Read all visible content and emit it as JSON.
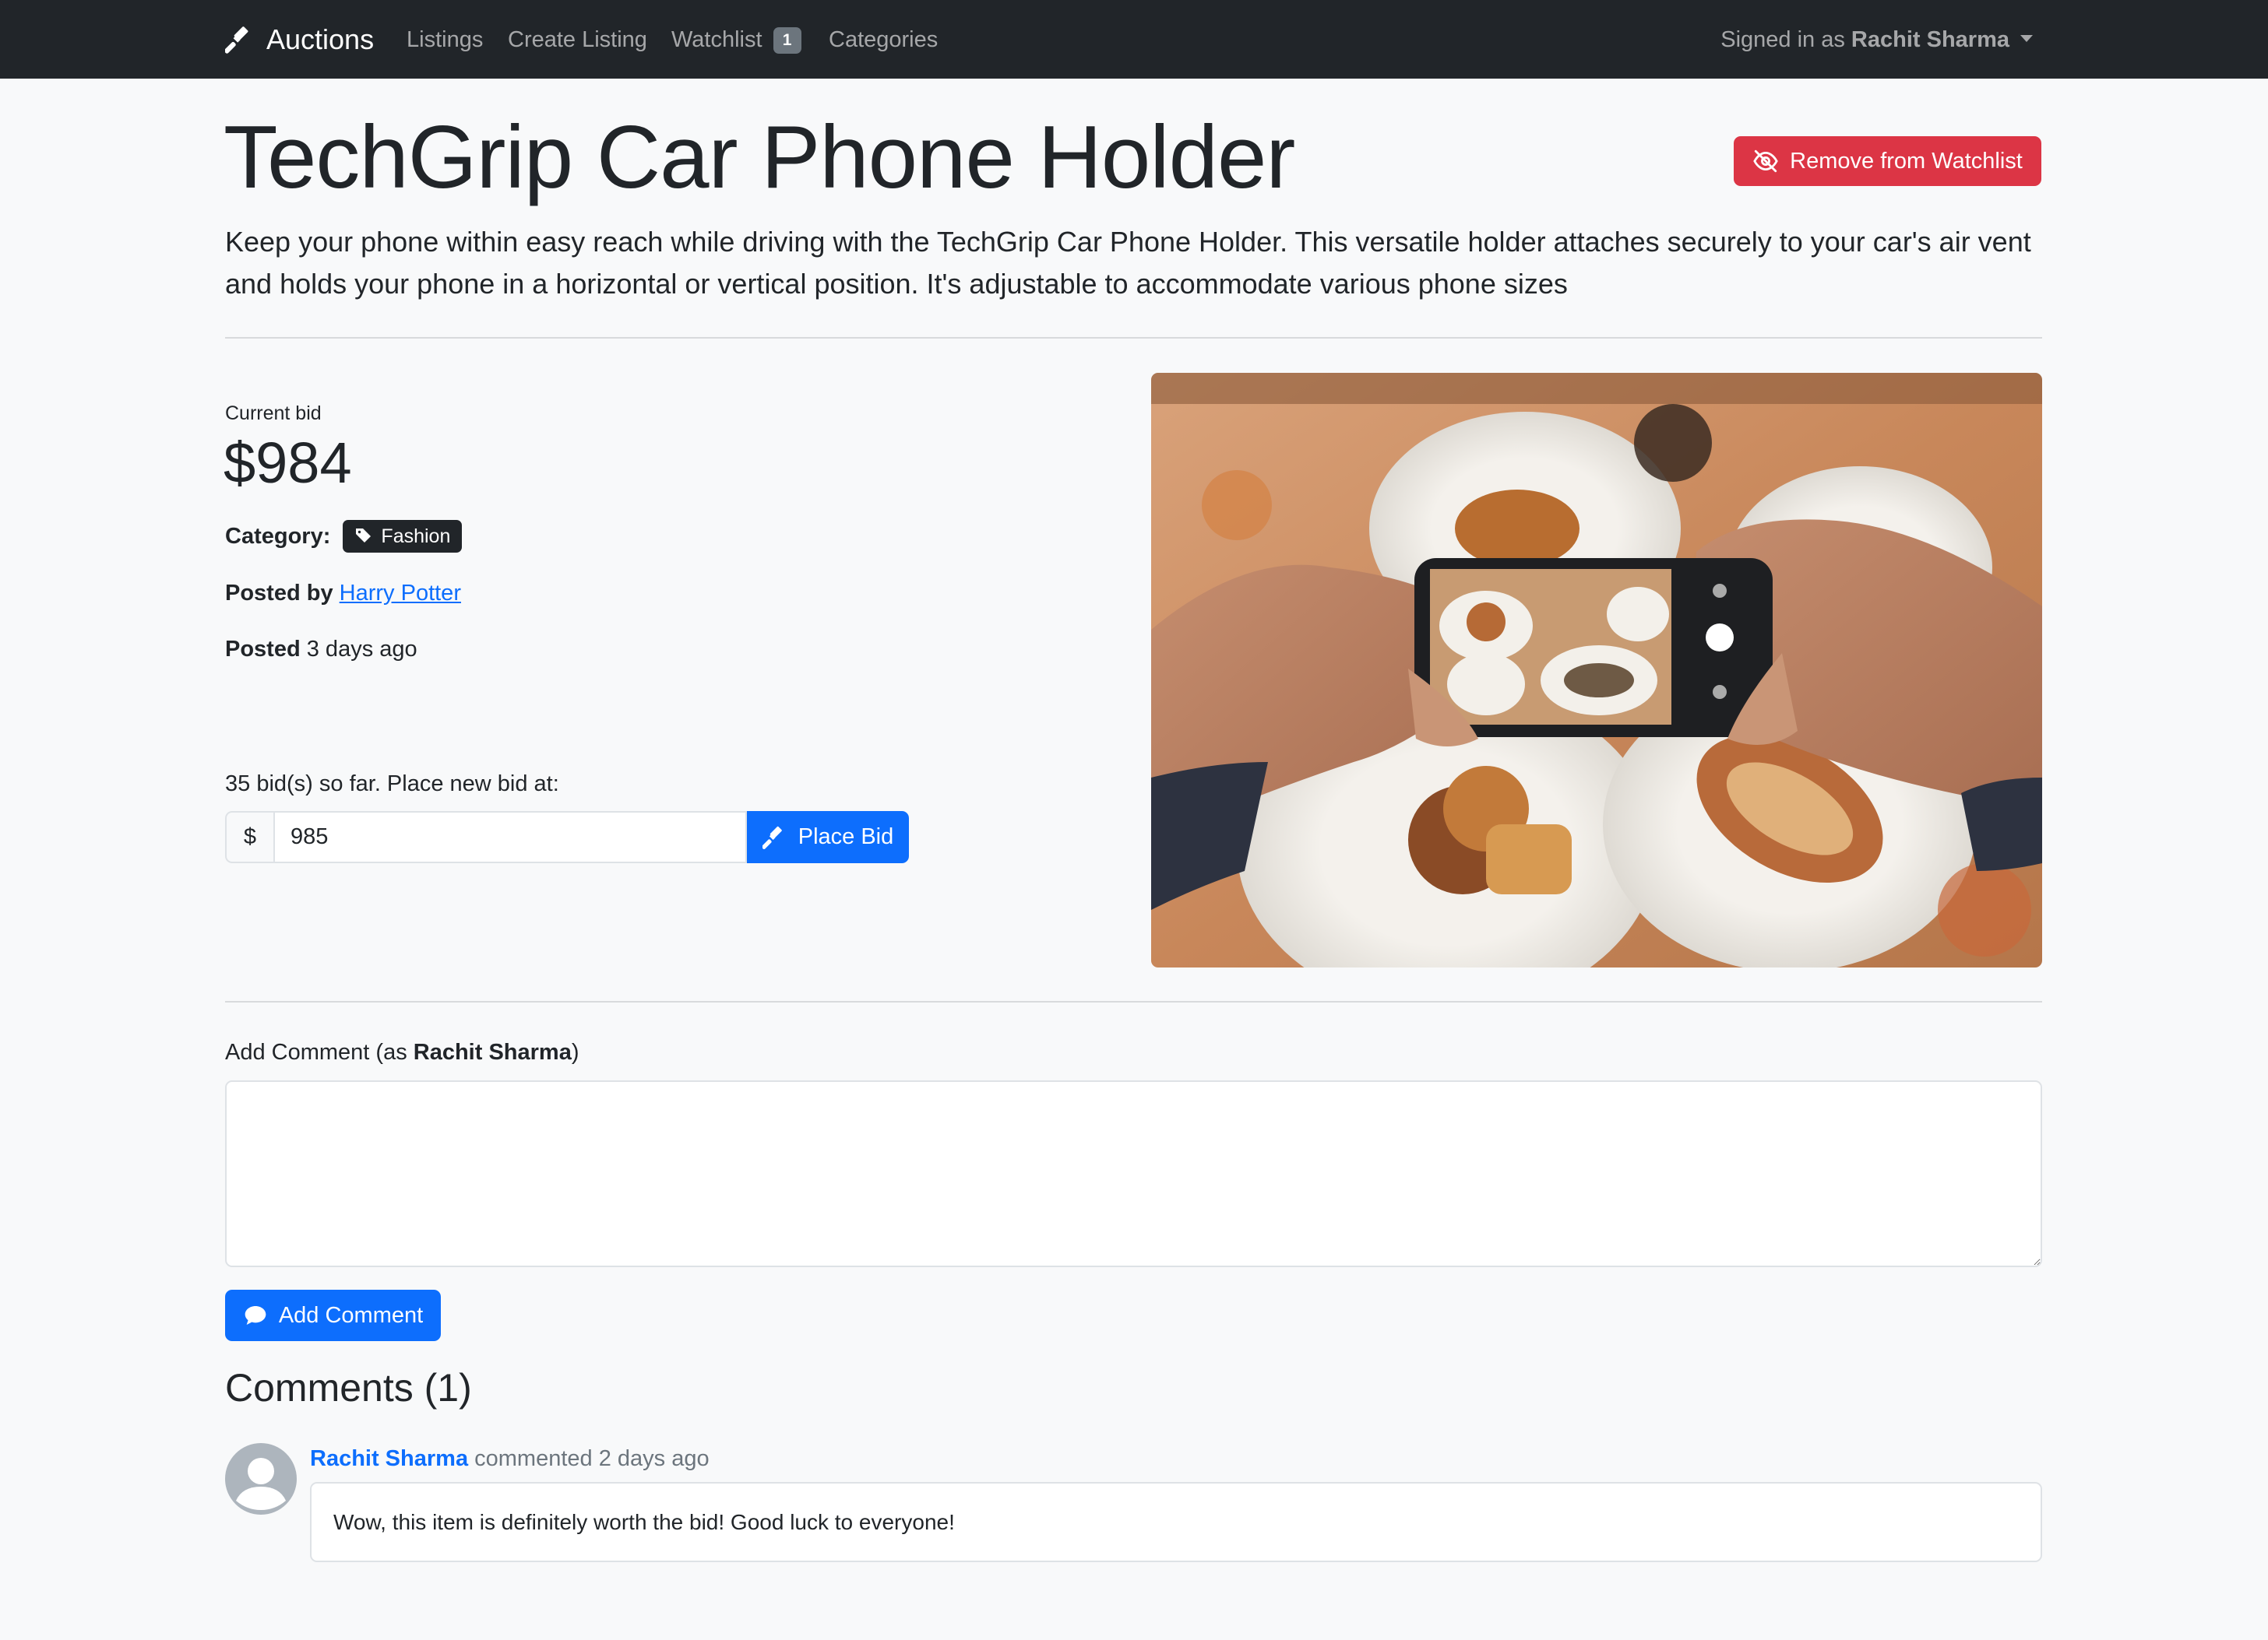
{
  "navbar": {
    "brand": "Auctions",
    "links": {
      "listings": "Listings",
      "create_listing": "Create Listing",
      "watchlist": "Watchlist",
      "watchlist_count": "1",
      "categories": "Categories"
    },
    "signed_in_prefix": "Signed in as ",
    "user_name": "Rachit Sharma"
  },
  "listing": {
    "title": "TechGrip Car Phone Holder",
    "description": "Keep your phone within easy reach while driving with the TechGrip Car Phone Holder. This versatile holder attaches securely to your car's air vent and holds your phone in a horizontal or vertical position. It's adjustable to accommodate various phone sizes",
    "watchlist_button": "Remove from Watchlist",
    "current_bid_label": "Current bid",
    "current_bid": "$984",
    "category_label": "Category:",
    "category": "Fashion",
    "posted_by_label": "Posted by",
    "posted_by": "Harry Potter",
    "posted_label": "Posted",
    "posted_time": "3 days ago",
    "image_icon": "photo-of-hands-holding-phone-over-food"
  },
  "bid": {
    "summary": "35 bid(s) so far. Place new bid at:",
    "currency": "$",
    "value": "985",
    "button": "Place Bid"
  },
  "comment_form": {
    "label_prefix": "Add Comment (as ",
    "user": "Rachit Sharma",
    "label_suffix": ")",
    "placeholder": "",
    "button": "Add Comment"
  },
  "comments": {
    "heading": "Comments (1)",
    "items": [
      {
        "author": "Rachit Sharma",
        "meta": " commented 2 days ago",
        "text": "Wow, this item is definitely worth the bid! Good luck to everyone!"
      }
    ]
  },
  "colors": {
    "navbar": "#212529",
    "primary": "#0d6efd",
    "danger": "#dc3545",
    "background": "#f8f9fa"
  }
}
